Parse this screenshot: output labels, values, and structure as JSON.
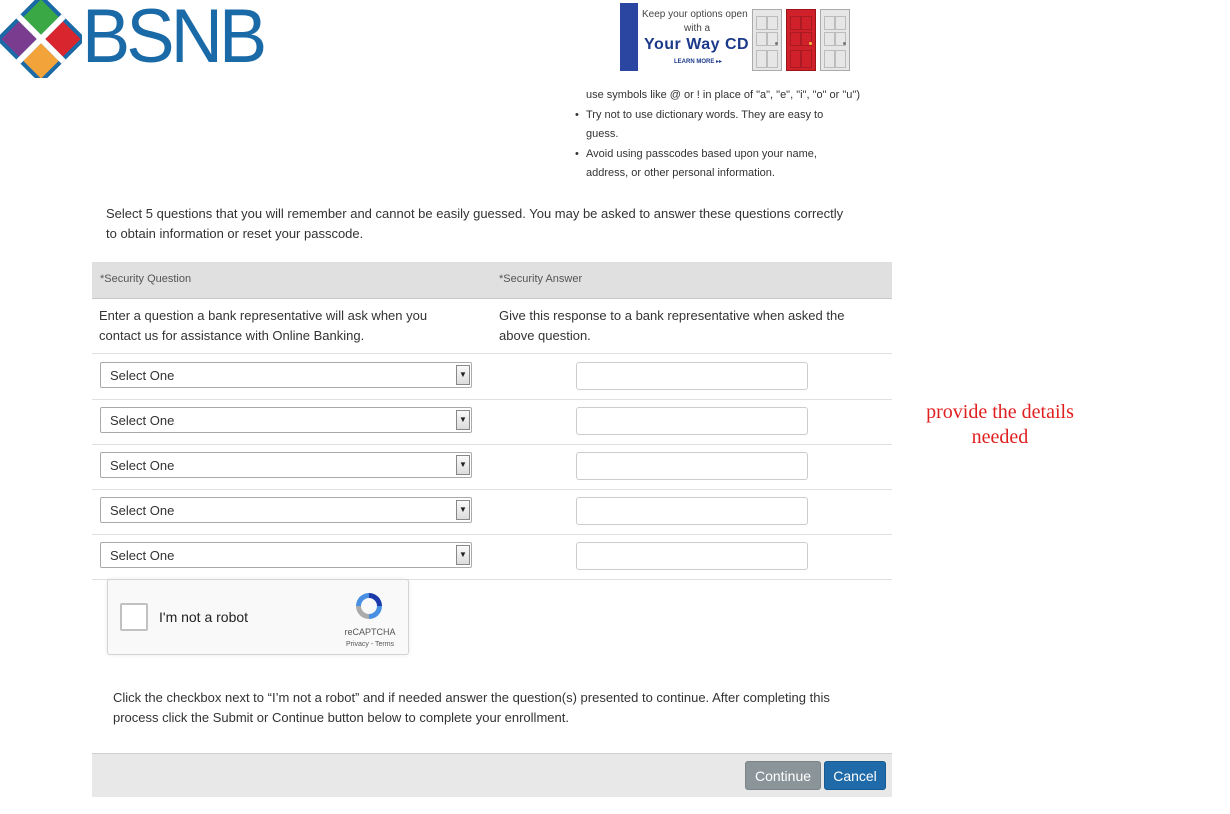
{
  "logo": {
    "text": "BSNB",
    "colors": {
      "text": "#1a6aa8",
      "green": "#3aa845",
      "red": "#d9262e",
      "purple": "#7a3c8f",
      "orange": "#f2a33a",
      "blue": "#1a6aa8"
    }
  },
  "ad": {
    "line1": "Keep your options open",
    "line2": "with a",
    "line3": "Your Way CD",
    "line4": "LEARN MORE ▸▸",
    "door_colors": [
      "#e8e8e8",
      "#d0202a",
      "#e8e8e8"
    ]
  },
  "tips": [
    {
      "text": "use symbols like @ or ! in place of \"a\", \"e\", \"i\", \"o\" or \"u\")",
      "bullet": ""
    },
    {
      "text": "Try not to use dictionary words. They are easy to",
      "bullet": "•"
    },
    {
      "text": "guess.",
      "bullet": ""
    },
    {
      "text": "Avoid using passcodes based upon your name,",
      "bullet": "•"
    },
    {
      "text": "address, or other personal information.",
      "bullet": ""
    }
  ],
  "intro": "Select 5 questions that you will remember and cannot be easily guessed. You may be asked to answer these questions correctly to obtain information or reset your passcode.",
  "table": {
    "header_question": "*Security Question",
    "header_answer": "*Security Answer",
    "desc_question": "Enter a question a bank representative will ask when you contact us for assistance with Online Banking.",
    "desc_answer": "Give this response to a bank representative when asked the above question.",
    "rows": [
      {
        "select": "Select One",
        "answer": ""
      },
      {
        "select": "Select One",
        "answer": ""
      },
      {
        "select": "Select One",
        "answer": ""
      },
      {
        "select": "Select One",
        "answer": ""
      },
      {
        "select": "Select One",
        "answer": ""
      }
    ]
  },
  "captcha": {
    "label": "I'm not a robot",
    "brand": "reCAPTCHA",
    "links": "Privacy - Terms"
  },
  "note": "Click the checkbox next to “I’m not a robot” and if needed answer the question(s) presented to continue. After completing this process click the Submit or Continue button below to complete your enrollment.",
  "buttons": {
    "continue": "Continue",
    "cancel": "Cancel"
  },
  "annotation": {
    "line1": "provide the details",
    "line2": "needed",
    "color": "#e02020"
  }
}
